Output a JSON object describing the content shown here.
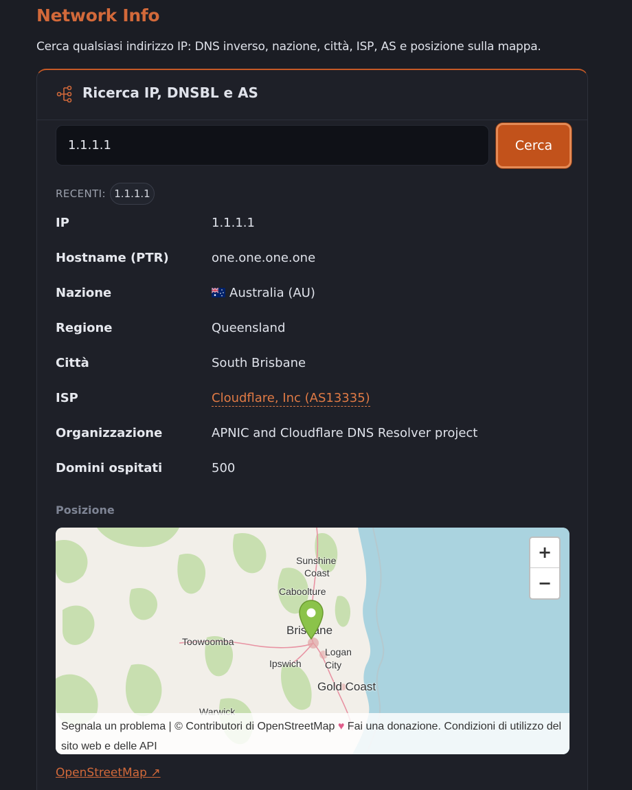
{
  "page": {
    "title": "Network Info",
    "subtitle": "Cerca qualsiasi indirizzo IP: DNS inverso, nazione, città, ISP, AS e posizione sulla mappa."
  },
  "card": {
    "title": "Ricerca IP, DNSBL e AS",
    "icon": "network-tree-icon"
  },
  "search": {
    "value": "1.1.1.1",
    "button_label": "Cerca"
  },
  "recent": {
    "label": "RECENTI:",
    "items": [
      "1.1.1.1"
    ]
  },
  "info": [
    {
      "key": "IP",
      "value": "1.1.1.1"
    },
    {
      "key": "Hostname (PTR)",
      "value": "one.one.one.one"
    },
    {
      "key": "Nazione",
      "value": "Australia (AU)",
      "flag": "australia-flag-icon"
    },
    {
      "key": "Regione",
      "value": "Queensland"
    },
    {
      "key": "Città",
      "value": "South Brisbane"
    },
    {
      "key": "ISP",
      "value": "Cloudflare, Inc (AS13335)",
      "link": true
    },
    {
      "key": "Organizzazione",
      "value": "APNIC and Cloudflare DNS Resolver project"
    },
    {
      "key": "Domini ospitati",
      "value": "500"
    }
  ],
  "map": {
    "section_label": "Posizione",
    "zoom_in": "+",
    "zoom_out": "−",
    "labels": {
      "sunshine": "Sunshine",
      "coast": "Coast",
      "caboolture": "Caboolture",
      "brisbane": "Brisbane",
      "toowoomba": "Toowoomba",
      "logan": "Logan",
      "city": "City",
      "ipswich": "Ipswich",
      "gold_coast": "Gold Coast",
      "warwick": "Warwick"
    },
    "attribution": {
      "part1": "Segnala un problema | © Contributori di OpenStreetMap",
      "heart": "♥",
      "part2": "Fai una donazione. Condizioni di utilizzo del sito web e delle API"
    },
    "colors": {
      "water": "#aad3df",
      "land": "#f2efe9",
      "forest": "#c8dfb0",
      "marker": "#8bc34a"
    }
  },
  "osm_link": "OpenStreetMap ↗"
}
